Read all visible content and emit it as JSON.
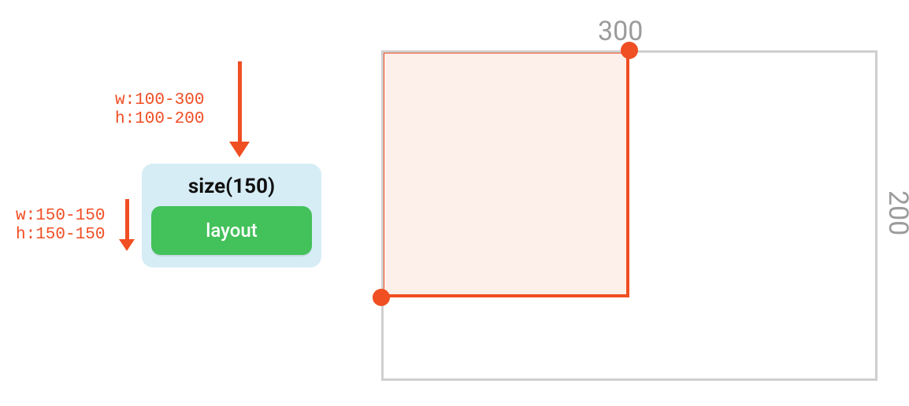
{
  "constraints": {
    "incomingLabel": "w:100-300\nh:100-200",
    "outgoingLabel": "w:150-150\nh:150-150"
  },
  "node": {
    "title": "size(150)",
    "childLabel": "layout"
  },
  "bounds": {
    "topLabel": "300",
    "rightLabel": "200"
  },
  "colors": {
    "accent": "#f04e23",
    "nodeBg": "#d6edf6",
    "childBg": "#43c15a",
    "outerBorder": "#cfcfcf",
    "dimLabel": "#9b9b9b"
  }
}
